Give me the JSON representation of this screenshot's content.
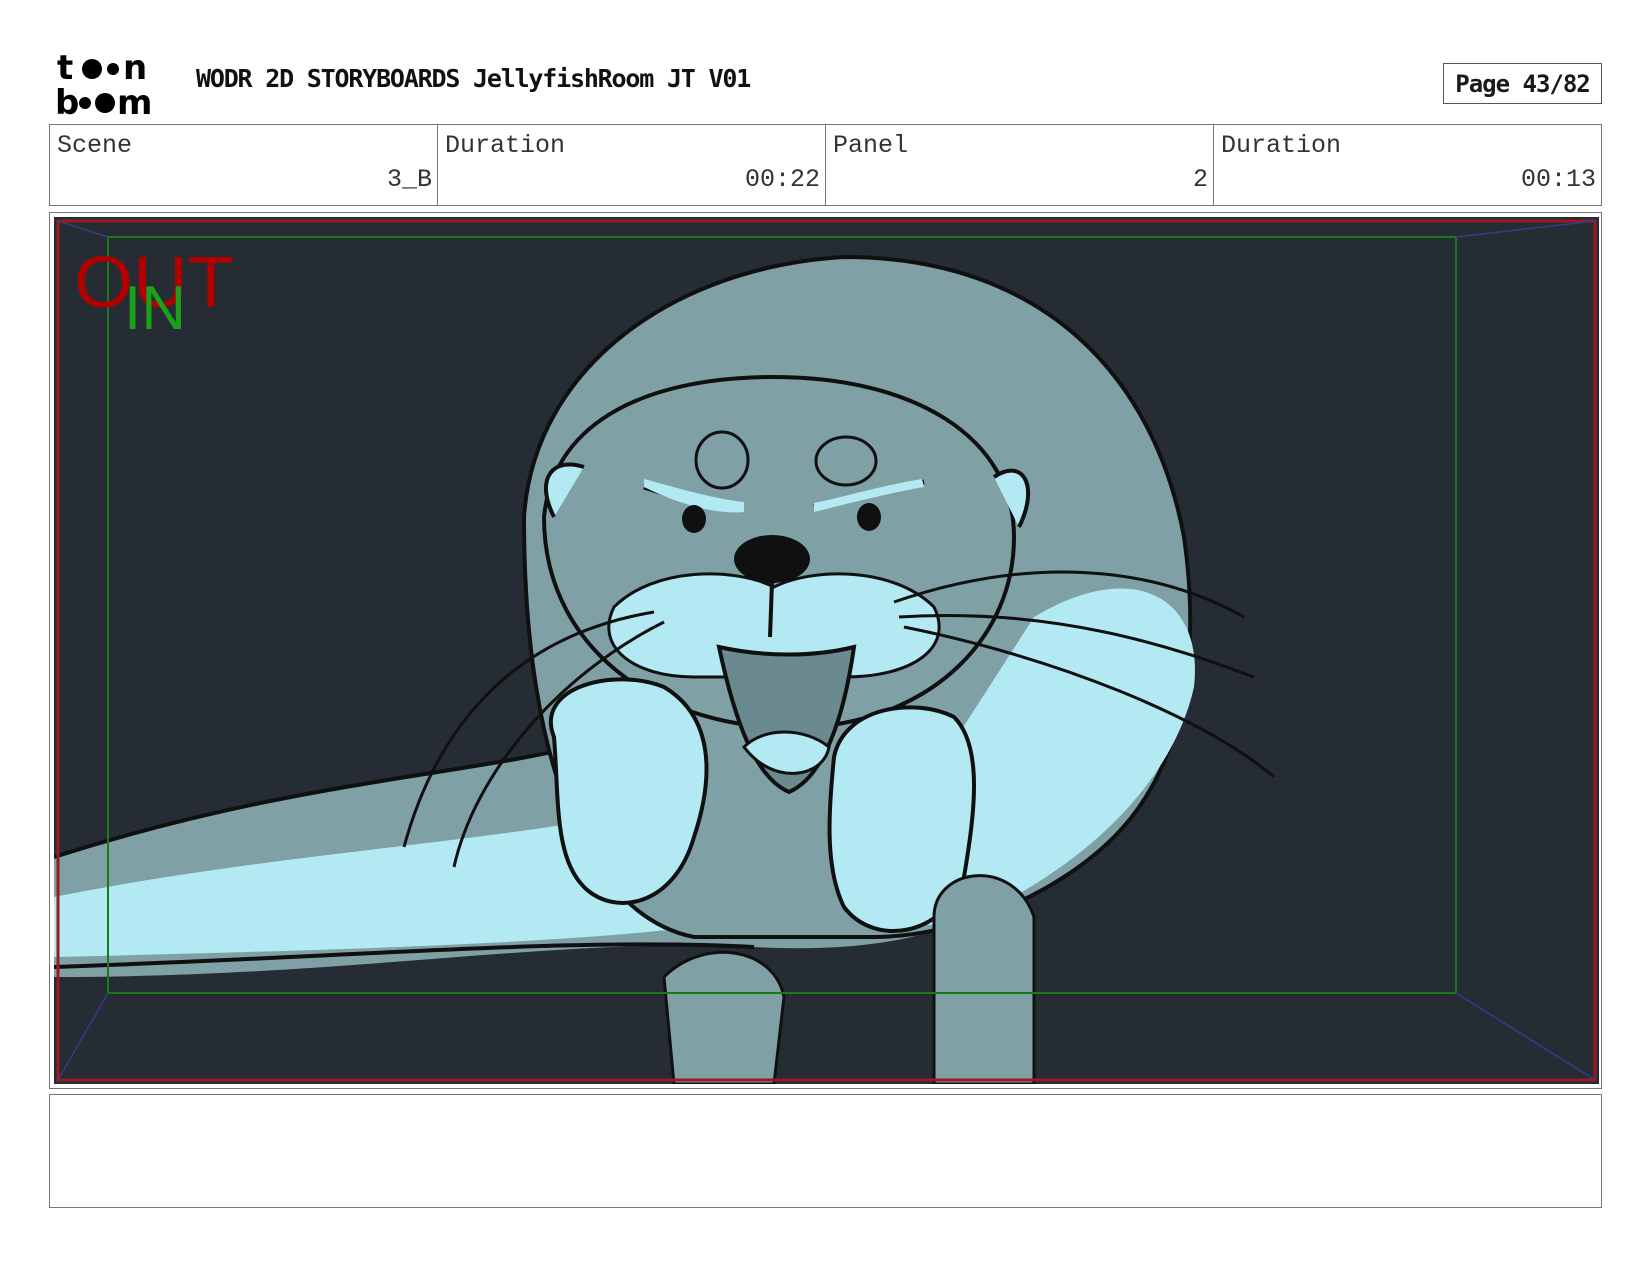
{
  "header": {
    "logo_text": "toon boom",
    "title": "WODR 2D STORYBOARDS JellyfishRoom JT V01",
    "page": "Page 43/82"
  },
  "info": {
    "scene_label": "Scene",
    "scene_value": "3_B",
    "scene_duration_label": "Duration",
    "scene_duration_value": "00:22",
    "panel_label": "Panel",
    "panel_value": "2",
    "panel_duration_label": "Duration",
    "panel_duration_value": "00:13"
  },
  "frame_markers": {
    "out_label": "OUT",
    "in_label": "IN",
    "out_color": "#b00000",
    "in_color": "#1aa01a"
  },
  "colors": {
    "background": "#252c33",
    "otter_body": "#7fa1a6",
    "otter_light": "#b2e9f2",
    "line": "#101010"
  },
  "notes": {
    "text": ""
  }
}
